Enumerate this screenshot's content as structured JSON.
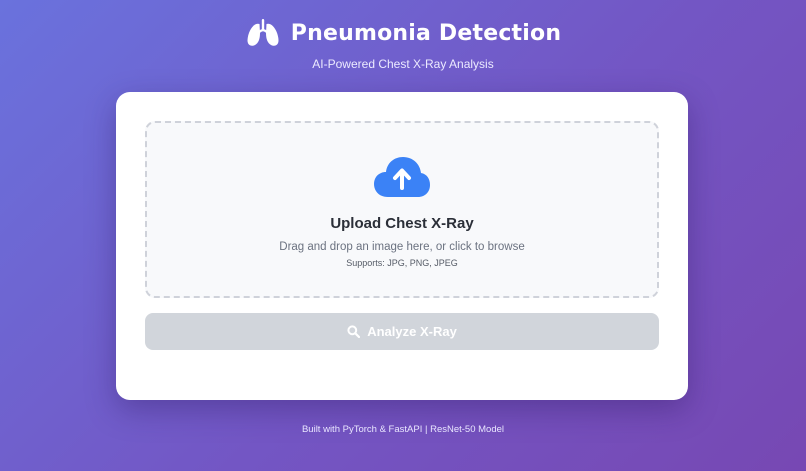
{
  "header": {
    "title": "Pneumonia Detection",
    "subtitle": "AI-Powered Chest X-Ray Analysis",
    "logo_icon": "lungs-icon"
  },
  "upload": {
    "icon": "cloud-upload-icon",
    "title": "Upload Chest X-Ray",
    "hint": "Drag and drop an image here, or click to browse",
    "formats": "Supports: JPG, PNG, JPEG"
  },
  "analyze": {
    "label": "Analyze X-Ray",
    "icon": "search-icon",
    "disabled": true
  },
  "footer": {
    "text": "Built with PyTorch & FastAPI | ResNet-50 Model"
  },
  "colors": {
    "accent": "#3b82f6",
    "button_disabled": "#d1d5db",
    "background_start": "#6a72dd",
    "background_end": "#7748b3"
  }
}
